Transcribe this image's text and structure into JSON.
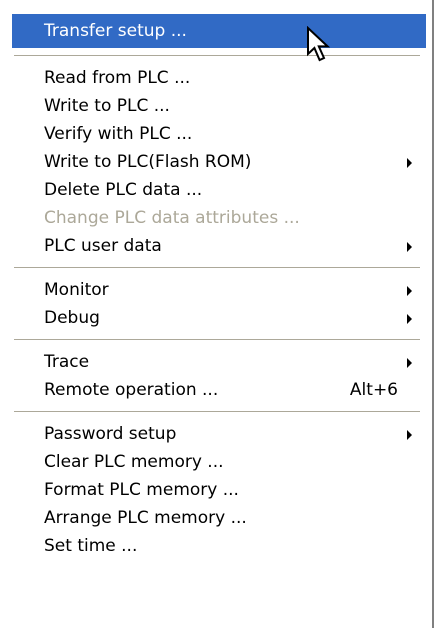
{
  "menu": {
    "groups": [
      [
        {
          "label": "Transfer setup ...",
          "highlighted": true
        }
      ],
      [
        {
          "label": "Read from PLC ..."
        },
        {
          "label": "Write to PLC ..."
        },
        {
          "label": "Verify with PLC ..."
        },
        {
          "label": "Write to PLC(Flash ROM)",
          "submenu": true
        },
        {
          "label": "Delete PLC data ..."
        },
        {
          "label": "Change PLC data attributes ...",
          "disabled": true
        },
        {
          "label": "PLC user data",
          "submenu": true
        }
      ],
      [
        {
          "label": "Monitor",
          "submenu": true
        },
        {
          "label": "Debug",
          "submenu": true
        }
      ],
      [
        {
          "label": "Trace",
          "submenu": true
        },
        {
          "label": "Remote operation ...",
          "shortcut": "Alt+6"
        }
      ],
      [
        {
          "label": "Password setup",
          "submenu": true
        },
        {
          "label": "Clear PLC memory ..."
        },
        {
          "label": "Format PLC memory ..."
        },
        {
          "label": "Arrange PLC memory ..."
        },
        {
          "label": "Set time ..."
        }
      ]
    ]
  },
  "colors": {
    "highlight": "#316ac5",
    "disabled_text": "#aca899",
    "separator": "#aca899"
  },
  "icons": {
    "pointer": "mouse-pointer-icon",
    "submenu": "submenu-arrow-icon"
  }
}
